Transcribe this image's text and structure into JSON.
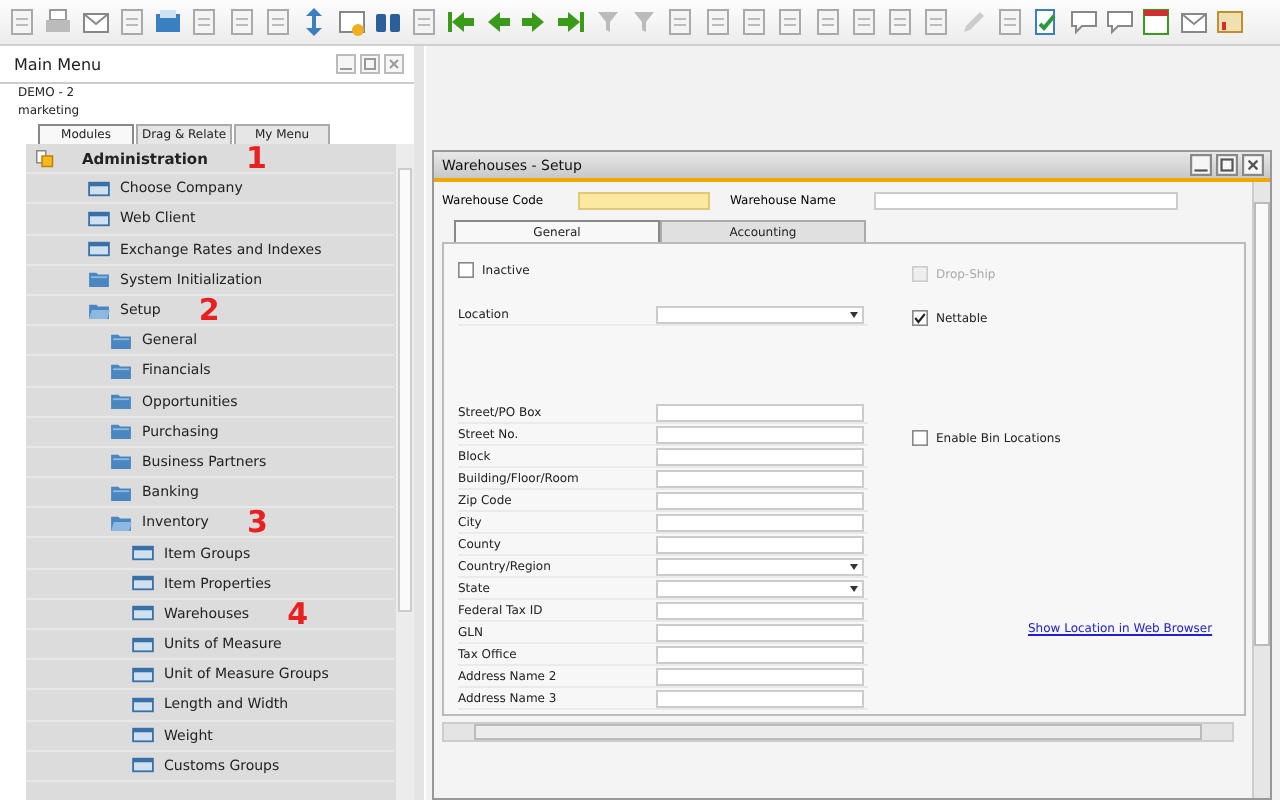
{
  "main_menu": {
    "title": "Main Menu",
    "company": "DEMO - 2",
    "user": "marketing",
    "tabs": [
      {
        "label": "Modules",
        "selected": true
      },
      {
        "label": "Drag & Relate",
        "selected": false
      },
      {
        "label": "My Menu",
        "selected": false
      }
    ],
    "items": [
      {
        "label": "Administration",
        "kind": "module",
        "annotation": "1",
        "children": [
          {
            "label": "Choose Company",
            "kind": "form"
          },
          {
            "label": "Web Client",
            "kind": "form"
          },
          {
            "label": "Exchange Rates and Indexes",
            "kind": "form"
          },
          {
            "label": "System Initialization",
            "kind": "folder",
            "expanded": false
          },
          {
            "label": "Setup",
            "kind": "folder",
            "expanded": true,
            "annotation": "2",
            "children": [
              {
                "label": "General",
                "kind": "folder",
                "expanded": false
              },
              {
                "label": "Financials",
                "kind": "folder",
                "expanded": false
              },
              {
                "label": "Opportunities",
                "kind": "folder",
                "expanded": false
              },
              {
                "label": "Purchasing",
                "kind": "folder",
                "expanded": false
              },
              {
                "label": "Business Partners",
                "kind": "folder",
                "expanded": false
              },
              {
                "label": "Banking",
                "kind": "folder",
                "expanded": false
              },
              {
                "label": "Inventory",
                "kind": "folder",
                "expanded": true,
                "annotation": "3",
                "children": [
                  {
                    "label": "Item Groups",
                    "kind": "form"
                  },
                  {
                    "label": "Item Properties",
                    "kind": "form"
                  },
                  {
                    "label": "Warehouses",
                    "kind": "form",
                    "annotation": "4"
                  },
                  {
                    "label": "Units of Measure",
                    "kind": "form"
                  },
                  {
                    "label": "Unit of Measure Groups",
                    "kind": "form"
                  },
                  {
                    "label": "Length and Width",
                    "kind": "form"
                  },
                  {
                    "label": "Weight",
                    "kind": "form"
                  },
                  {
                    "label": "Customs Groups",
                    "kind": "form"
                  }
                ]
              }
            ]
          }
        ]
      }
    ]
  },
  "form": {
    "title": "Warehouses - Setup",
    "code_label": "Warehouse Code",
    "name_label": "Warehouse Name",
    "tabs": [
      {
        "label": "General",
        "selected": true
      },
      {
        "label": "Accounting",
        "selected": false
      }
    ],
    "inactive": {
      "label": "Inactive",
      "checked": false
    },
    "location": {
      "label": "Location"
    },
    "address_fields": [
      {
        "label": "Street/PO Box",
        "kind": "text"
      },
      {
        "label": "Street No.",
        "kind": "text"
      },
      {
        "label": "Block",
        "kind": "text"
      },
      {
        "label": "Building/Floor/Room",
        "kind": "text"
      },
      {
        "label": "Zip Code",
        "kind": "text"
      },
      {
        "label": "City",
        "kind": "text"
      },
      {
        "label": "County",
        "kind": "text"
      },
      {
        "label": "Country/Region",
        "kind": "dropdown"
      },
      {
        "label": "State",
        "kind": "dropdown"
      },
      {
        "label": "Federal Tax ID",
        "kind": "text"
      },
      {
        "label": "GLN",
        "kind": "text"
      },
      {
        "label": "Tax Office",
        "kind": "text"
      },
      {
        "label": "Address Name 2",
        "kind": "text"
      },
      {
        "label": "Address Name 3",
        "kind": "text"
      }
    ],
    "options": [
      {
        "label": "Drop-Ship",
        "checked": false,
        "disabled": true
      },
      {
        "label": "Nettable",
        "checked": true,
        "disabled": false
      },
      {
        "label": "Enable Bin Locations",
        "checked": false,
        "disabled": false
      }
    ],
    "link": "Show Location in Web Browser"
  }
}
